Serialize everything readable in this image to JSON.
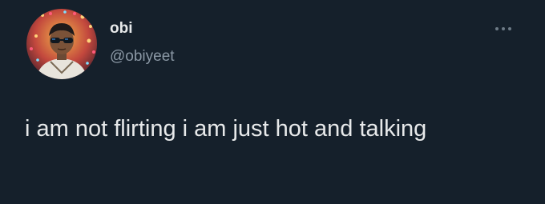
{
  "tweet": {
    "display_name": "obi",
    "handle": "@obiyeet",
    "text": "i am not flirting i am just hot and talking",
    "avatar_icon": "profile-photo",
    "more_icon": "more-options-icon"
  },
  "colors": {
    "background": "#15202b",
    "primary_text": "#e7e9ea",
    "secondary_text": "#8b98a5"
  }
}
